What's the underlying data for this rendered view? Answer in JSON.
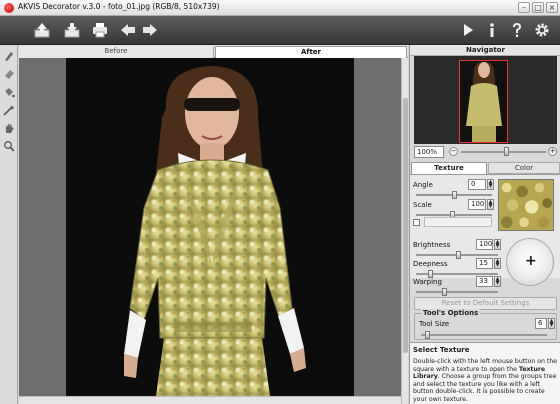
{
  "window": {
    "title": "AKVIS Decorator v.3.0 - foto_01.jpg (RGB/8, 510x739)"
  },
  "toolbar": {
    "left_icons": [
      "open-image-icon",
      "save-image-icon",
      "print-icon",
      "undo-arrow-icon",
      "redo-arrow-icon"
    ],
    "right_icons": [
      "run-icon",
      "info-icon",
      "help-icon",
      "settings-icon"
    ]
  },
  "left_tools": [
    "brush-tool-icon",
    "eraser-tool-icon",
    "bucket-tool-icon",
    "magic-wand-icon",
    "hand-tool-icon",
    "zoom-tool-icon"
  ],
  "view_tabs": {
    "before": "Before",
    "after": "After"
  },
  "navigator": {
    "title": "Navigator",
    "zoom": "100%"
  },
  "panel_tabs": {
    "texture": "Texture",
    "color": "Color"
  },
  "texture": {
    "angle_label": "Angle",
    "angle_value": "0",
    "scale_label": "Scale",
    "scale_value": "100"
  },
  "adjust": {
    "brightness_label": "Brightness",
    "brightness_value": "100",
    "deepness_label": "Deepness",
    "deepness_value": "15",
    "warping_label": "Warping",
    "warping_value": "33"
  },
  "reset_button": "Reset to Default Settings",
  "tool_options": {
    "title": "Tool's Options",
    "tool_size_label": "Tool Size",
    "tool_size_value": "6"
  },
  "help": {
    "title": "Select Texture",
    "line1": "Double-click with the left mouse button on the square with a texture to open the ",
    "link": "Texture Library",
    "line2": ". Choose a group from the groups tree and select the texture you like with a left button double-click. It is possible to create your own texture."
  },
  "colors": {
    "toolbar_bg": "#4a4a4a",
    "navigator_frame": "#e33333",
    "panel_bg": "#d9d9d9"
  }
}
